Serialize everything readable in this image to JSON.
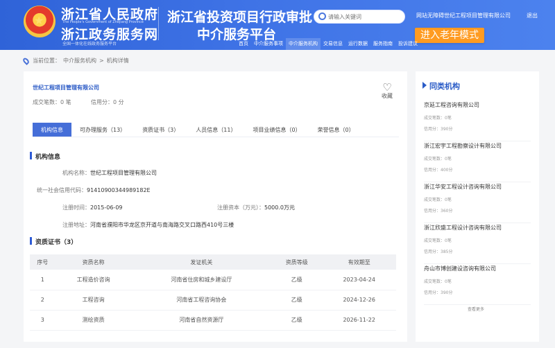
{
  "header": {
    "gov_title": "浙江省人民政府",
    "gov_subtitle": "The People's Government of Zhejiang Province",
    "service_title": "浙江政务服务网",
    "service_subtitle": "全国一体化在线政务服务平台",
    "platform_title_line1": "浙江省投资项目行政审批",
    "platform_title_line2": "中介服务平台",
    "search_placeholder": "请输入关键词",
    "welcome_text": "网站无障碍世纪工程项目管理有限公司",
    "logout_text": "退出",
    "elder_mode_text": "进入老年模式",
    "nav": [
      "首页",
      "中介服务事项",
      "中介服务机构",
      "交易信息",
      "运行数据",
      "服务指南",
      "投诉建议"
    ]
  },
  "breadcrumb": {
    "current_label": "当前位置：",
    "path1": "中介服务机构",
    "separator": ">",
    "path2": "机构详情"
  },
  "company": {
    "name": "世纪工程项目管理有限公司",
    "deals_label": "成交笔数：",
    "deals_value": "0 笔",
    "credit_label": "信用分：",
    "credit_value": "0 分",
    "favorite_label": "收藏"
  },
  "tabs": [
    "机构信息",
    "可办理服务（13）",
    "资质证书（3）",
    "人员信息（11）",
    "项目业绩信息（0）",
    "荣誉信息（0）"
  ],
  "institution_info": {
    "section_title": "机构信息",
    "name_label": "机构名称：",
    "name_value": "世纪工程项目管理有限公司",
    "code_label": "统一社会信用代码：",
    "code_value": "91410900344989182E",
    "reg_time_label": "注册时间：",
    "reg_time_value": "2015-06-09",
    "reg_capital_label": "注册资本（万元）：",
    "reg_capital_value": "5000.0万元",
    "reg_address_label": "注册地址：",
    "reg_address_value": "河南省濮阳市华龙区京开道与南海路交叉口路西410号三楼"
  },
  "certificates": {
    "section_title": "资质证书（3）",
    "headers": [
      "序号",
      "资质名称",
      "发证机关",
      "资质等级",
      "有效期至"
    ],
    "rows": [
      [
        "1",
        "工程造价咨询",
        "河南省住房和城乡建设厅",
        "乙级",
        "2023-04-24"
      ],
      [
        "2",
        "工程咨询",
        "河南省工程咨询协会",
        "乙级",
        "2024-12-26"
      ],
      [
        "3",
        "测绘资质",
        "河南省自然资源厅",
        "乙级",
        "2026-11-22"
      ]
    ]
  },
  "similar_orgs": {
    "title": "同类机构",
    "items": [
      {
        "name": "京延工程咨询有限公司",
        "deals": "成交笔数：0笔",
        "credit": "信用分：390分"
      },
      {
        "name": "浙江宏宇工程勘察设计有限公司",
        "deals": "成交笔数：0笔",
        "credit": "信用分：400分"
      },
      {
        "name": "浙江华安工程设计咨询有限公司",
        "deals": "成交笔数：0笔",
        "credit": "信用分：360分"
      },
      {
        "name": "浙江欣盛工程设计咨询有限公司",
        "deals": "成交笔数：0笔",
        "credit": "信用分：385分"
      },
      {
        "name": "舟山市博创建设咨询有限公司",
        "deals": "成交笔数：0笔",
        "credit": "信用分：390分"
      }
    ],
    "more_text": "查看更多"
  }
}
